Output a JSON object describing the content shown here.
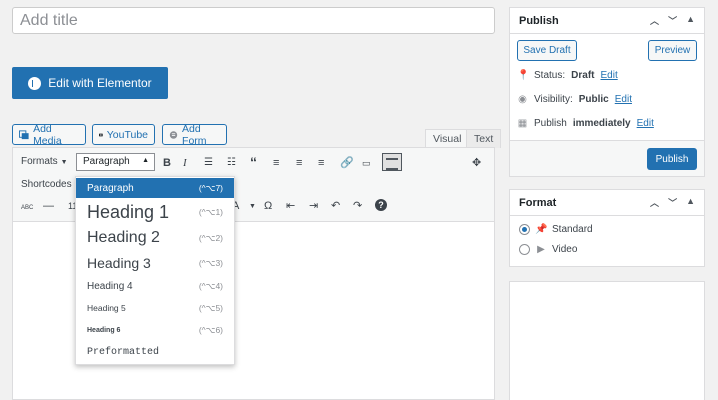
{
  "title_placeholder": "Add title",
  "elementor_button": "Edit with Elementor",
  "media_buttons": {
    "add_media": "Add Media",
    "youtube": "YouTube",
    "add_form": "Add Form"
  },
  "editor_tabs": {
    "visual": "Visual",
    "text": "Text"
  },
  "toolbar": {
    "formats": "Formats",
    "paragraph_select": "Paragraph",
    "shortcodes": "Shortcodes",
    "line_height_value": "11"
  },
  "format_dropdown": [
    {
      "label": "Paragraph",
      "shortcut": "(^⌥7)"
    },
    {
      "label": "Heading 1",
      "shortcut": "(^⌥1)"
    },
    {
      "label": "Heading 2",
      "shortcut": "(^⌥2)"
    },
    {
      "label": "Heading 3",
      "shortcut": "(^⌥3)"
    },
    {
      "label": "Heading 4",
      "shortcut": "(^⌥4)"
    },
    {
      "label": "Heading 5",
      "shortcut": "(^⌥5)"
    },
    {
      "label": "Heading 6",
      "shortcut": "(^⌥6)"
    },
    {
      "label": "Preformatted",
      "shortcut": ""
    }
  ],
  "publish": {
    "title": "Publish",
    "save_draft": "Save Draft",
    "preview": "Preview",
    "status_label": "Status:",
    "status_value": "Draft",
    "visibility_label": "Visibility:",
    "visibility_value": "Public",
    "publish_label": "Publish",
    "publish_value": "immediately",
    "edit": "Edit",
    "publish_button": "Publish"
  },
  "format_box": {
    "title": "Format",
    "options": [
      "Standard",
      "Video"
    ],
    "selected": "Standard"
  },
  "colors": {
    "accent": "#2271b1",
    "background": "#f1f1f1"
  }
}
